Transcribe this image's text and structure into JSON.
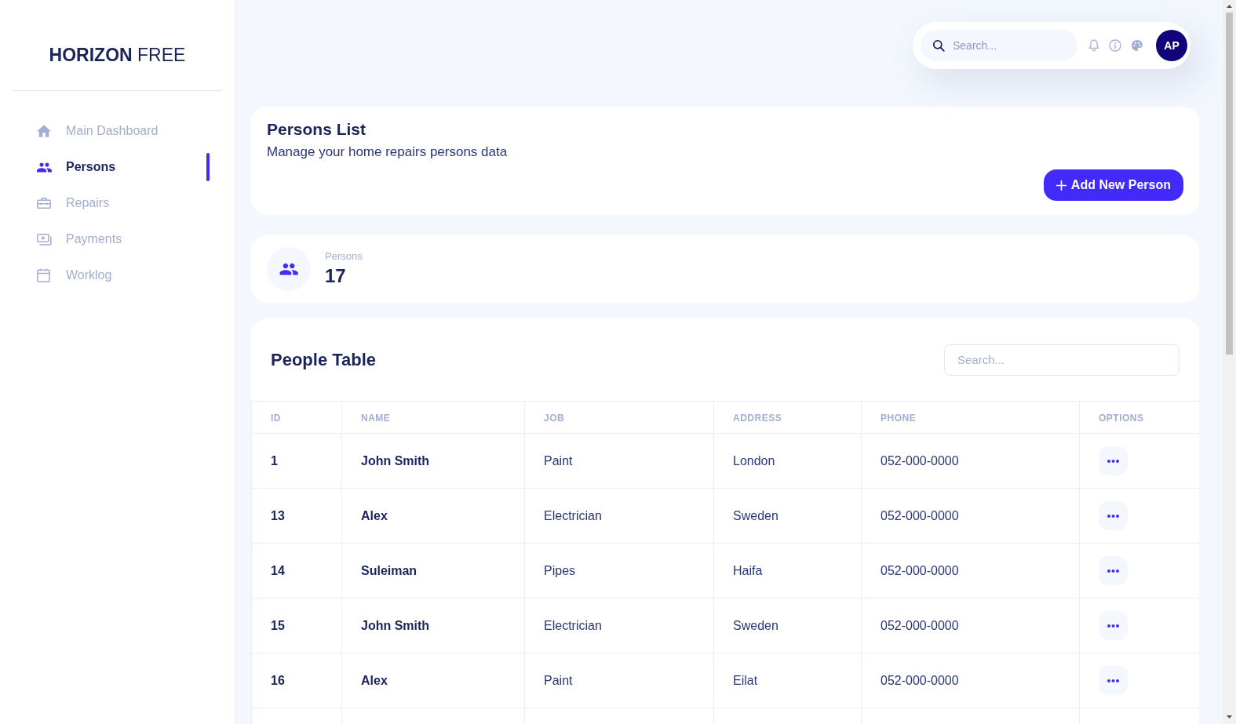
{
  "sidebar": {
    "brand": {
      "strong": "HORIZON",
      "light": "FREE"
    },
    "items": [
      {
        "label": "Main Dashboard",
        "selected": false
      },
      {
        "label": "Persons",
        "selected": true
      },
      {
        "label": "Repairs",
        "selected": false
      },
      {
        "label": "Payments",
        "selected": false
      },
      {
        "label": "Worklog",
        "selected": false
      }
    ]
  },
  "navbar": {
    "search": {
      "placeholder": "Search..."
    },
    "avatar": "AP"
  },
  "header_card": {
    "title": "Persons List",
    "subtitle": "Manage your home repairs persons data",
    "button": "Add New Person"
  },
  "stat_card": {
    "label": "Persons",
    "value": "17"
  },
  "table": {
    "title": "People Table",
    "search": {
      "placeholder": "Search..."
    },
    "columns": [
      "ID",
      "NAME",
      "JOB",
      "ADDRESS",
      "PHONE",
      "OPTIONS"
    ],
    "rows": [
      [
        "1",
        "John Smith",
        "Paint",
        "London",
        "052-000-0000"
      ],
      [
        "13",
        "Alex",
        "Electrician",
        "Sweden",
        "052-000-0000"
      ],
      [
        "14",
        "Suleiman",
        "Pipes",
        "Haifa",
        "052-000-0000"
      ],
      [
        "15",
        "John Smith",
        "Electrician",
        "Sweden",
        "052-000-0000"
      ],
      [
        "16",
        "Alex",
        "Paint",
        "Eilat",
        "052-000-0000"
      ]
    ]
  }
}
